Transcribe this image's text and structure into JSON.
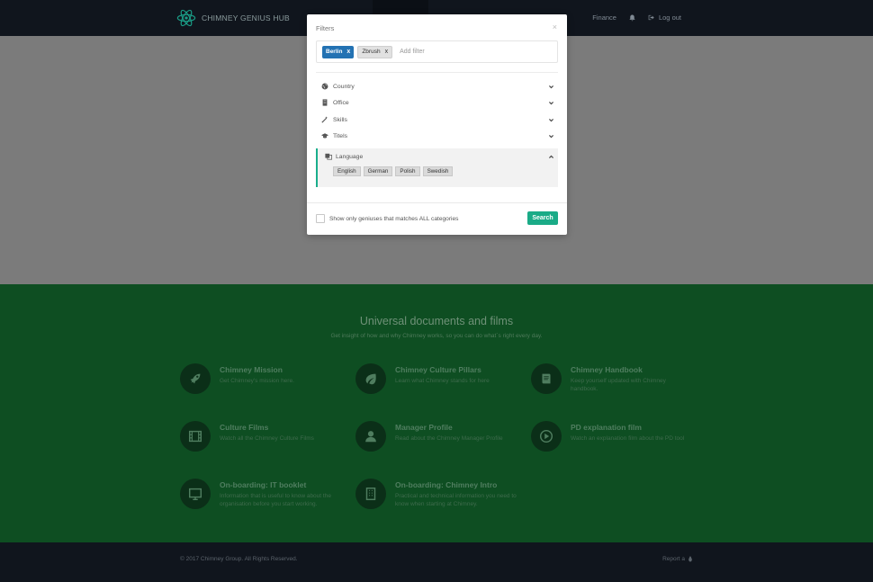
{
  "navbar": {
    "brand": "CHIMNEY GENIUS HUB",
    "finance": "Finance",
    "logout": "Log out"
  },
  "modal": {
    "title": "Filters",
    "close": "×",
    "tags": [
      {
        "label": "Berlin",
        "remove": "x"
      },
      {
        "label": "Zbrush",
        "remove": "x"
      }
    ],
    "add_filter_placeholder": "Add filter",
    "categories": [
      {
        "label": "Country",
        "icon": "globe-icon"
      },
      {
        "label": "Office",
        "icon": "building-icon"
      },
      {
        "label": "Skills",
        "icon": "magic-icon"
      },
      {
        "label": "Titels",
        "icon": "graduation-cap-icon"
      }
    ],
    "language": {
      "label": "Language",
      "options": [
        "English",
        "German",
        "Polish",
        "Swedish"
      ]
    },
    "match_all_label": "Show only geniuses that matches ALL categories",
    "search_button": "Search"
  },
  "resources": {
    "title": "Universal documents and films",
    "subtitle": "Get insight of how and why Chimney works, so you can do what´s right every day.",
    "items": [
      {
        "title": "Chimney Mission",
        "desc": "Get Chimney's mission here.",
        "icon": "rocket-icon"
      },
      {
        "title": "Chimney Culture Pillars",
        "desc": "Learn what Chimney stands for here",
        "icon": "leaf-icon"
      },
      {
        "title": "Chimney Handbook",
        "desc": "Keep yourself updated with Chimney handbook.",
        "icon": "book-icon"
      },
      {
        "title": "Culture Films",
        "desc": "Watch all the Chimney Culture Films",
        "icon": "film-icon"
      },
      {
        "title": "Manager Profile",
        "desc": "Read about the Chimney Manager Profile",
        "icon": "user-icon"
      },
      {
        "title": "PD explanation film",
        "desc": "Watch an explanation film about the PD tool",
        "icon": "play-icon"
      },
      {
        "title": "On-boarding: IT booklet",
        "desc": "Information that is useful to know about the organisation before you start working.",
        "icon": "monitor-icon"
      },
      {
        "title": "On-boarding: Chimney Intro",
        "desc": "Practical and technical information you need to know when starting at Chimney.",
        "icon": "building-icon"
      }
    ]
  },
  "footer": {
    "copyright": "© 2017 Chimney Group. All Rights Reserved.",
    "report": "Report a"
  }
}
